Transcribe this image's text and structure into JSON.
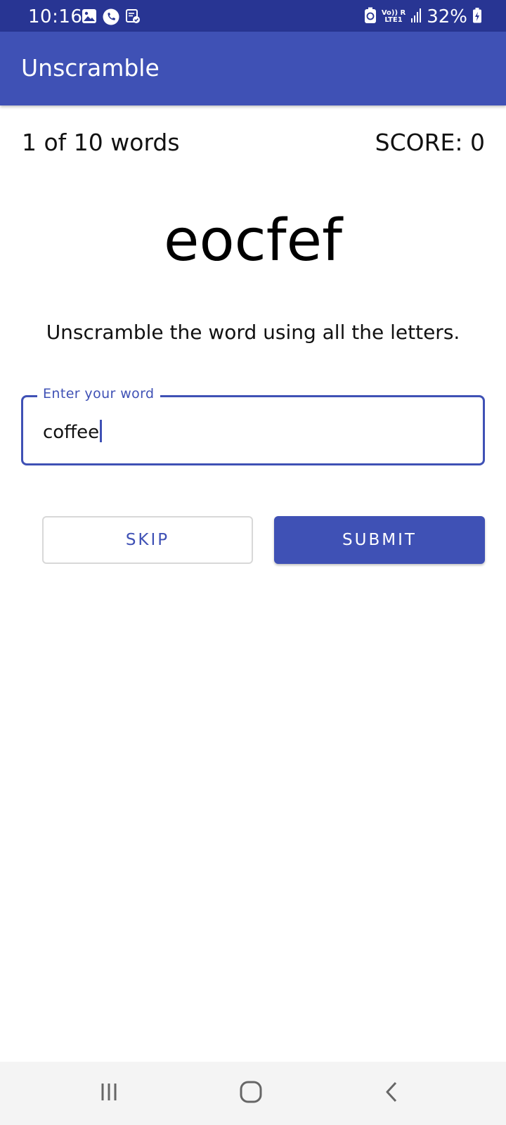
{
  "status_bar": {
    "time": "10:16",
    "network_top": "Vo)) R",
    "network_bottom": "LTE1",
    "battery": "32%",
    "icons": [
      "image-icon",
      "phone-icon",
      "clipboard-check-icon",
      "battery-saver-icon",
      "signal-icon",
      "battery-charging-icon"
    ]
  },
  "app_bar": {
    "title": "Unscramble",
    "color": "#3f51b5",
    "status_color": "#283593"
  },
  "game": {
    "word_count": "1 of 10 words",
    "score": "SCORE: 0",
    "scrambled_word": "eocfef",
    "instructions": "Unscramble the word using all the letters."
  },
  "input": {
    "label": "Enter your word",
    "value": "coffee"
  },
  "buttons": {
    "skip": "SKIP",
    "submit": "SUBMIT"
  },
  "nav_bar": {
    "icons": [
      "recent-apps-icon",
      "home-icon",
      "back-icon"
    ]
  }
}
